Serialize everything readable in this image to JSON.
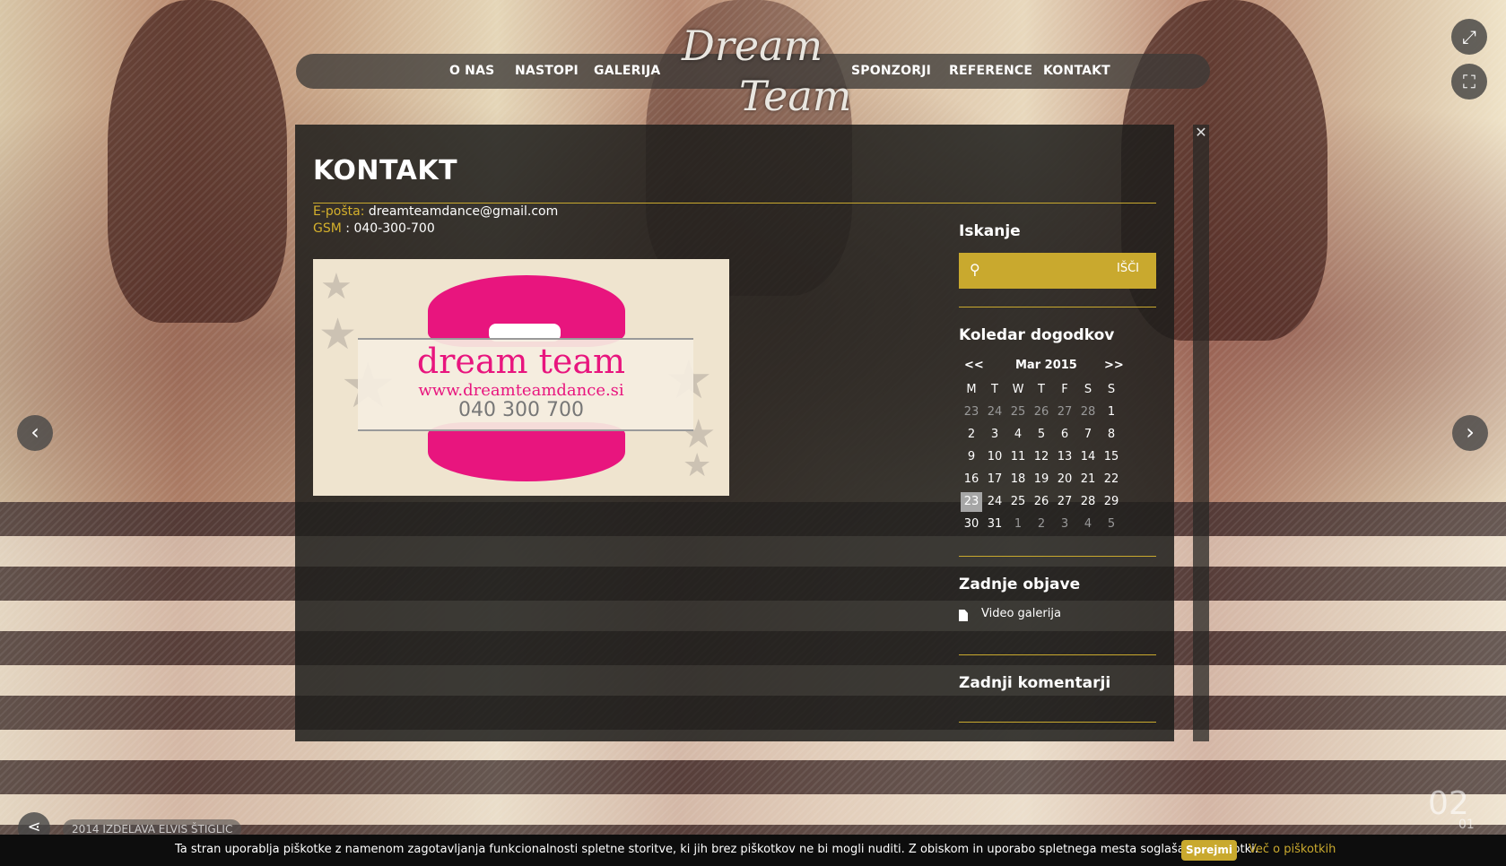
{
  "nav": {
    "left": [
      "O NAS",
      "NASTOPI",
      "GALERIJA"
    ],
    "right": [
      "SPONZORJI",
      "REFERENCE",
      "KONTAKT"
    ]
  },
  "logo": {
    "line1": "Dream",
    "line2": "Team"
  },
  "page": {
    "title": "KONTAKT",
    "email_label": "E-pošta:",
    "email": "dreamteamdance@gmail.com",
    "gsm_label": "GSM",
    "gsm_sep": " :",
    "gsm": "040-300-700"
  },
  "card": {
    "name": "dream team",
    "url": "www.dreamteamdance.si",
    "phone": "040 300 700"
  },
  "sidebar": {
    "search_title": "Iskanje",
    "search_placeholder": "",
    "search_button": "IŠČI",
    "calendar_title": "Koledar dogodkov",
    "recent_title": "Zadnje objave",
    "recent_posts": [
      "Video galerija"
    ],
    "comments_title": "Zadnji komentarji"
  },
  "calendar": {
    "prev": "<<",
    "next": ">>",
    "month": "Mar 2015",
    "weekdays": [
      "M",
      "T",
      "W",
      "T",
      "F",
      "S",
      "S"
    ],
    "weeks": [
      [
        "23",
        "24",
        "25",
        "26",
        "27",
        "28",
        "1"
      ],
      [
        "2",
        "3",
        "4",
        "5",
        "6",
        "7",
        "8"
      ],
      [
        "9",
        "10",
        "11",
        "12",
        "13",
        "14",
        "15"
      ],
      [
        "16",
        "17",
        "18",
        "19",
        "20",
        "21",
        "22"
      ],
      [
        "23",
        "24",
        "25",
        "26",
        "27",
        "28",
        "29"
      ],
      [
        "30",
        "31",
        "1",
        "2",
        "3",
        "4",
        "5"
      ]
    ],
    "today": "23"
  },
  "slider": {
    "current": "02",
    "next": "01"
  },
  "footer": {
    "credit": "2014 IZDELAVA ELVIS ŠTIGLIC"
  },
  "cookie": {
    "message": "Ta stran uporablja piškotke z namenom zagotavljanja funkcionalnosti spletne storitve, ki jih brez piškotkov ne bi mogli nuditi. Z obiskom in uporabo spletnega mesta soglašate s piškotki.",
    "accept": "Sprejmi",
    "more": "Več o piškotkih"
  },
  "icons": {
    "fullscreen": "fullscreen-icon",
    "fit": "fit-screen-icon",
    "search": "search-icon",
    "close": "close-icon",
    "share": "share-icon",
    "prev": "chevron-left-icon",
    "next": "chevron-right-icon",
    "doc": "document-icon"
  },
  "colors": {
    "accent": "#c9a92e",
    "panel": "#1e1e1c",
    "cookie_bar": "#0d0d0d",
    "lips": "#e8157e"
  }
}
